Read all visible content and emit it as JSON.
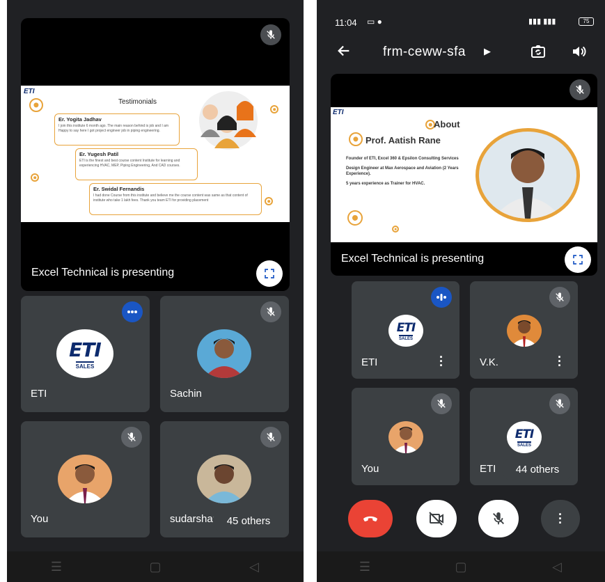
{
  "left": {
    "presentation": {
      "label": "Excel Technical is presenting",
      "slide": {
        "logo": "ETI",
        "title": "Testimonials",
        "items": [
          {
            "name": "Er. Yogita Jadhav",
            "text": "I join this institute 6 month ago. The main reason behind is job and I am Happy to say here I got project engineer job in piping engineering."
          },
          {
            "name": "Er. Yugesh Patil",
            "text": "ETI is the finest and best course content Institute for learning and experiencing HVAC, MEP, Piping Engineering, And CAD courses."
          },
          {
            "name": "Er. Swidal Fernandis",
            "text": "I had done Course from this institute and believe me the course content was same as that content of institute who take 1 lakh fees. Thank you team ETI for providing placement"
          }
        ]
      }
    },
    "tiles": [
      {
        "name": "ETI",
        "status": "speaking"
      },
      {
        "name": "Sachin",
        "status": "muted"
      },
      {
        "name": "You",
        "status": "muted"
      },
      {
        "name": "sudarshan",
        "status": "muted",
        "overlay": "45 others"
      }
    ],
    "logo_text": "ETI",
    "logo_sub": "SALES"
  },
  "right": {
    "status": {
      "time": "11:04",
      "battery": "75"
    },
    "meeting_code": "frm-ceww-sfa",
    "presentation": {
      "label": "Excel Technical is presenting",
      "slide": {
        "logo": "ETI",
        "section": "About",
        "person": "Prof. Aatish Rane",
        "lines": [
          "Founder of ETI, Excel 360 & Epsilon Consulting Services",
          "Design Engineer at Max Aerospace and Aviation (2 Years Experience).",
          "5 years experience as Trainer for HVAC."
        ]
      }
    },
    "tiles": [
      {
        "name": "ETI",
        "status": "speaking"
      },
      {
        "name": "V.K.",
        "status": "muted"
      },
      {
        "name": "You",
        "status": "muted"
      },
      {
        "name": "ETI",
        "status": "muted",
        "overlay": "44 others"
      }
    ],
    "logo_text": "ETI",
    "logo_sub": "SALES"
  },
  "colors": {
    "bg": "#202124",
    "tile": "#3c4043",
    "end_call": "#ea4335",
    "accent": "#1a56c4",
    "slide_orange": "#e8a33a"
  },
  "icons": [
    "mic-off-icon",
    "fullscreen-icon",
    "back-arrow-icon",
    "switch-camera-icon",
    "speaker-icon",
    "end-call-icon",
    "camera-off-icon",
    "more-vert-icon"
  ]
}
